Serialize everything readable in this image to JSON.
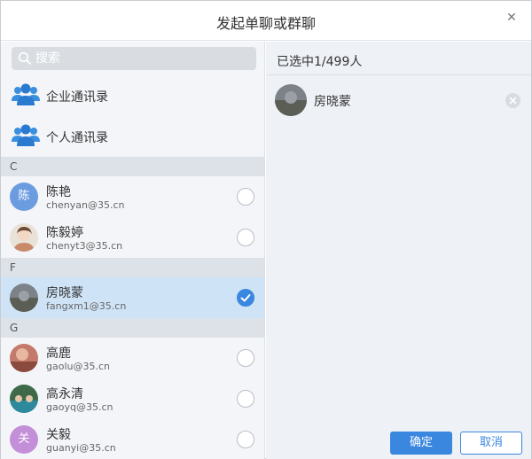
{
  "dialog": {
    "title": "发起单聊或群聊",
    "close_icon": "close-icon"
  },
  "search": {
    "placeholder": "搜索",
    "value": ""
  },
  "directories": [
    {
      "label": "企业通讯录",
      "icon": "people-group-icon"
    },
    {
      "label": "个人通讯录",
      "icon": "people-group-icon"
    }
  ],
  "groups": [
    {
      "letter": "C",
      "contacts": [
        {
          "name": "陈艳",
          "email": "chenyan@35.cn",
          "avatar_text": "陈",
          "checked": false
        },
        {
          "name": "陈毅婷",
          "email": "chenyt3@35.cn",
          "avatar_text": "",
          "checked": false
        }
      ]
    },
    {
      "letter": "F",
      "contacts": [
        {
          "name": "房晓蒙",
          "email": "fangxm1@35.cn",
          "avatar_text": "",
          "checked": true
        }
      ]
    },
    {
      "letter": "G",
      "contacts": [
        {
          "name": "高鹿",
          "email": "gaolu@35.cn",
          "avatar_text": "",
          "checked": false
        },
        {
          "name": "高永清",
          "email": "gaoyq@35.cn",
          "avatar_text": "",
          "checked": false
        },
        {
          "name": "关毅",
          "email": "guanyi@35.cn",
          "avatar_text": "关",
          "checked": false
        }
      ]
    }
  ],
  "selected_panel": {
    "count_text": "已选中1/499人",
    "items": [
      {
        "name": "房晓蒙"
      }
    ]
  },
  "buttons": {
    "ok": "确定",
    "cancel": "取消"
  },
  "colors": {
    "accent": "#3a87e0",
    "selected_row": "#cfe3f7"
  }
}
